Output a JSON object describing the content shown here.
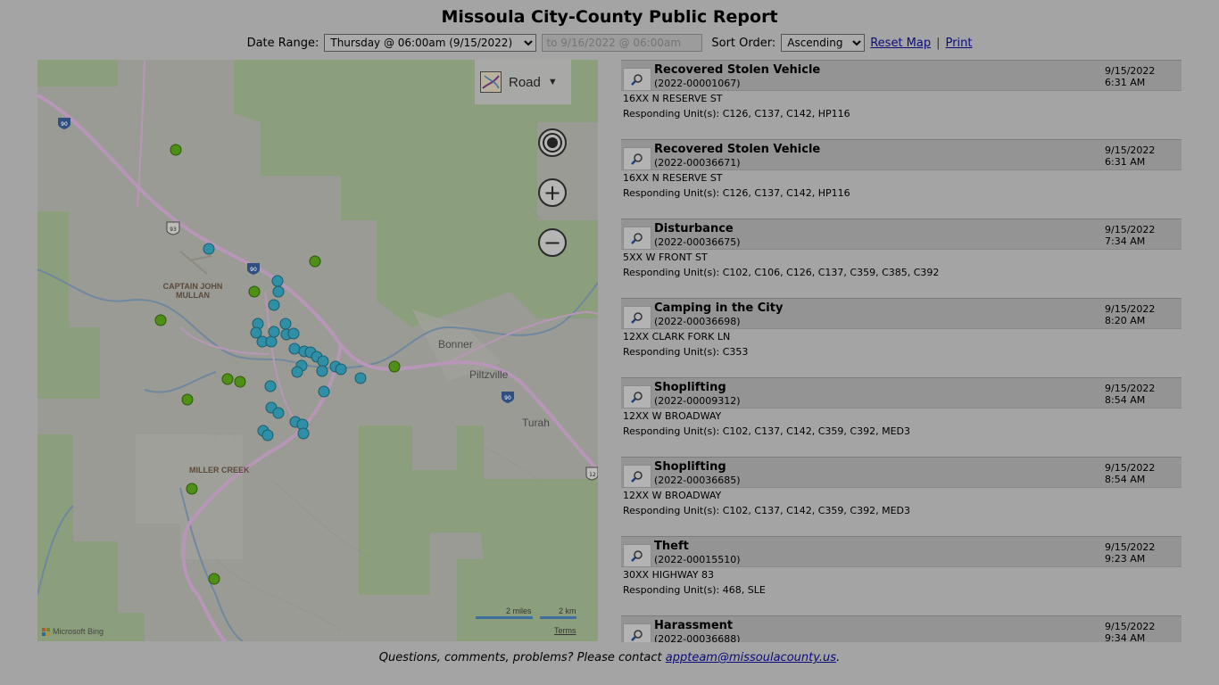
{
  "title": "Missoula City-County Public Report",
  "controls": {
    "date_range_label": "Date Range:",
    "date_range_value": "Thursday @ 06:00am (9/15/2022)",
    "to_placeholder": "to 9/16/2022 @ 06:00am",
    "sort_label": "Sort Order:",
    "sort_value": "Ascending",
    "reset_map": "Reset Map",
    "separator": "|",
    "print": "Print"
  },
  "map": {
    "style_label": "Road",
    "labels": {
      "bonner": "Bonner",
      "piltzville": "Piltzville",
      "turah": "Turah",
      "captain_john_mullan": "CAPTAIN JOHN MULLAN",
      "miller_creek": "MILLER CREEK",
      "hwy_93": "93",
      "i90_a": "90",
      "i90_b": "90",
      "i90_c": "90",
      "hwy_12": "12"
    },
    "scale_miles": "2 miles",
    "scale_km": "2 km",
    "attribution": "Microsoft Bing",
    "terms": "Terms",
    "colors": {
      "blue_pin": "#2f8fa6",
      "green_pin": "#4e8f16",
      "road": "#b896b8",
      "forest": "#8c9f7c"
    }
  },
  "incidents": [
    {
      "type": "Recovered Stolen Vehicle",
      "number": "(2022-00001067)",
      "date": "9/15/2022",
      "time": "6:31 AM",
      "address": "16XX N RESERVE ST",
      "units": "Responding Unit(s): C126, C137, C142, HP116"
    },
    {
      "type": "Recovered Stolen Vehicle",
      "number": "(2022-00036671)",
      "date": "9/15/2022",
      "time": "6:31 AM",
      "address": "16XX N RESERVE ST",
      "units": "Responding Unit(s): C126, C137, C142, HP116"
    },
    {
      "type": "Disturbance",
      "number": "(2022-00036675)",
      "date": "9/15/2022",
      "time": "7:34 AM",
      "address": "5XX W FRONT ST",
      "units": "Responding Unit(s): C102, C106, C126, C137, C359, C385, C392"
    },
    {
      "type": "Camping in the City",
      "number": "(2022-00036698)",
      "date": "9/15/2022",
      "time": "8:20 AM",
      "address": "12XX CLARK FORK LN",
      "units": "Responding Unit(s): C353"
    },
    {
      "type": "Shoplifting",
      "number": "(2022-00009312)",
      "date": "9/15/2022",
      "time": "8:54 AM",
      "address": "12XX W BROADWAY",
      "units": "Responding Unit(s): C102, C137, C142, C359, C392, MED3"
    },
    {
      "type": "Shoplifting",
      "number": "(2022-00036685)",
      "date": "9/15/2022",
      "time": "8:54 AM",
      "address": "12XX W BROADWAY",
      "units": "Responding Unit(s): C102, C137, C142, C359, C392, MED3"
    },
    {
      "type": "Theft",
      "number": "(2022-00015510)",
      "date": "9/15/2022",
      "time": "9:23 AM",
      "address": "30XX HIGHWAY 83",
      "units": "Responding Unit(s): 468, SLE"
    },
    {
      "type": "Harassment",
      "number": "(2022-00036688)",
      "date": "9/15/2022",
      "time": "9:34 AM",
      "address": "",
      "units": ""
    }
  ],
  "footer": {
    "text": "Questions, comments, problems? Please contact ",
    "email": "appteam@missoulacounty.us",
    "end": "."
  }
}
